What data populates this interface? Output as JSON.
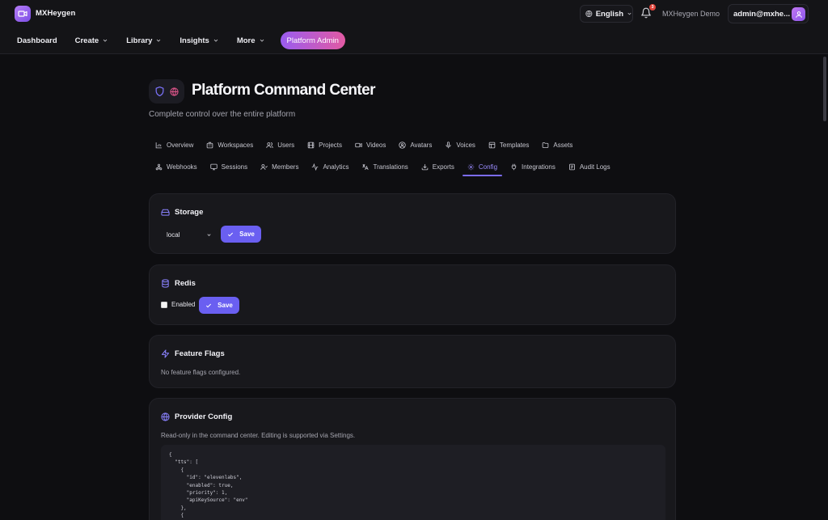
{
  "app": {
    "name": "MXHeygen"
  },
  "header": {
    "language": "English",
    "notifications_count": "3",
    "workspace": "MXHeygen Demo",
    "user_email": "admin@mxhe..."
  },
  "nav": {
    "items": [
      {
        "label": "Dashboard",
        "has_dropdown": false
      },
      {
        "label": "Create",
        "has_dropdown": true
      },
      {
        "label": "Library",
        "has_dropdown": true
      },
      {
        "label": "Insights",
        "has_dropdown": true
      },
      {
        "label": "More",
        "has_dropdown": true
      }
    ],
    "admin_label": "Platform Admin"
  },
  "page": {
    "title": "Platform Command Center",
    "subtitle": "Complete control over the entire platform"
  },
  "tabs": {
    "row1": [
      {
        "label": "Overview",
        "icon": "bar-chart-icon"
      },
      {
        "label": "Workspaces",
        "icon": "building-icon"
      },
      {
        "label": "Users",
        "icon": "users-icon"
      },
      {
        "label": "Projects",
        "icon": "film-icon"
      },
      {
        "label": "Videos",
        "icon": "video-icon"
      },
      {
        "label": "Avatars",
        "icon": "user-circle-icon"
      },
      {
        "label": "Voices",
        "icon": "mic-icon"
      },
      {
        "label": "Templates",
        "icon": "layout-icon"
      },
      {
        "label": "Assets",
        "icon": "folder-icon"
      }
    ],
    "row2": [
      {
        "label": "Webhooks",
        "icon": "webhook-icon"
      },
      {
        "label": "Sessions",
        "icon": "monitor-icon"
      },
      {
        "label": "Members",
        "icon": "members-icon"
      },
      {
        "label": "Analytics",
        "icon": "activity-icon"
      },
      {
        "label": "Translations",
        "icon": "languages-icon"
      },
      {
        "label": "Exports",
        "icon": "download-icon"
      },
      {
        "label": "Config",
        "icon": "gear-icon"
      },
      {
        "label": "Integrations",
        "icon": "plug-icon"
      },
      {
        "label": "Audit Logs",
        "icon": "scroll-icon"
      }
    ],
    "active": "Config"
  },
  "storage": {
    "title": "Storage",
    "selected": "local",
    "save_label": "Save"
  },
  "redis": {
    "title": "Redis",
    "enabled_label": "Enabled",
    "enabled": false,
    "save_label": "Save"
  },
  "feature_flags": {
    "title": "Feature Flags",
    "empty_text": "No feature flags configured."
  },
  "provider_config": {
    "title": "Provider Config",
    "description": "Read-only in the command center. Editing is supported via Settings.",
    "code": "{\n  \"tts\": [\n    {\n      \"id\": \"elevenlabs\",\n      \"enabled\": true,\n      \"priority\": 1,\n      \"apiKeySource\": \"env\"\n    },\n    {"
  },
  "colors": {
    "accent": "#6a5ff1",
    "active_tab": "#9b8cff",
    "admin_gradient_start": "#9a5cf0",
    "admin_gradient_end": "#e25aa3",
    "badge": "#e0453c",
    "background": "#0e0e11",
    "card": "#18181c"
  }
}
